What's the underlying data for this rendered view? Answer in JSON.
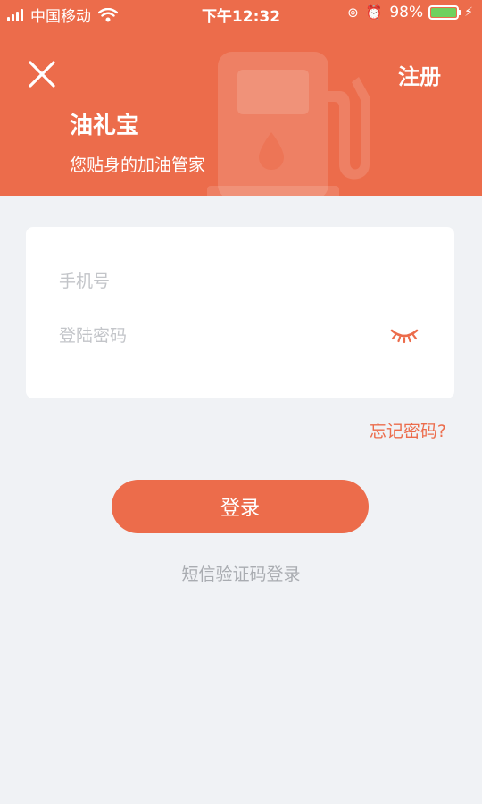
{
  "status_bar": {
    "carrier": "中国移动",
    "time": "下午12:32",
    "battery_percent": "98%",
    "battery_level": 0.98,
    "icons": [
      "signal-icon",
      "wifi-icon",
      "screen-lock-icon",
      "alarm-icon",
      "battery-icon",
      "charging-icon"
    ]
  },
  "header": {
    "close_icon": "close-icon",
    "register_label": "注册",
    "app_title": "油礼宝",
    "slogan": "您贴身的加油管家",
    "decoration_icon": "fuel-pump-icon"
  },
  "form": {
    "phone_placeholder": "手机号",
    "phone_value": "",
    "password_placeholder": "登陆密码",
    "password_value": "",
    "eye_icon": "eye-closed-icon",
    "forgot_label": "忘记密码?",
    "login_label": "登录",
    "sms_login_label": "短信验证码登录"
  },
  "colors": {
    "brand": "#ec6c4b",
    "background": "#f0f2f5",
    "card": "#ffffff",
    "placeholder": "#c3c5c9",
    "secondary_text": "#a9acb1",
    "battery": "#6fd15f"
  }
}
